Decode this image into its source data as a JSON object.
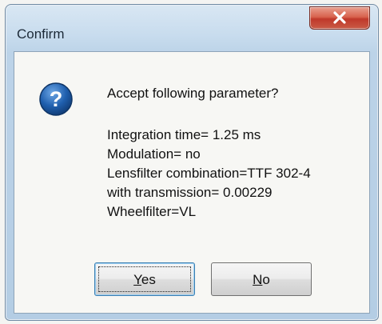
{
  "dialog": {
    "title": "Confirm",
    "close_icon": "close-icon",
    "icon": "question-icon",
    "question": "Accept following parameter?",
    "parameters": [
      "Integration time= 1.25 ms",
      "Modulation= no",
      "Lensfilter combination=TTF 302-4",
      "with transmission= 0.00229",
      "Wheelfilter=VL"
    ],
    "buttons": {
      "yes": {
        "mnemonic": "Y",
        "rest": "es"
      },
      "no": {
        "mnemonic": "N",
        "rest": "o"
      }
    }
  },
  "colors": {
    "close_button": "#c0392b",
    "question_icon": "#1f5fae",
    "focus_border": "#3c7fb1"
  }
}
